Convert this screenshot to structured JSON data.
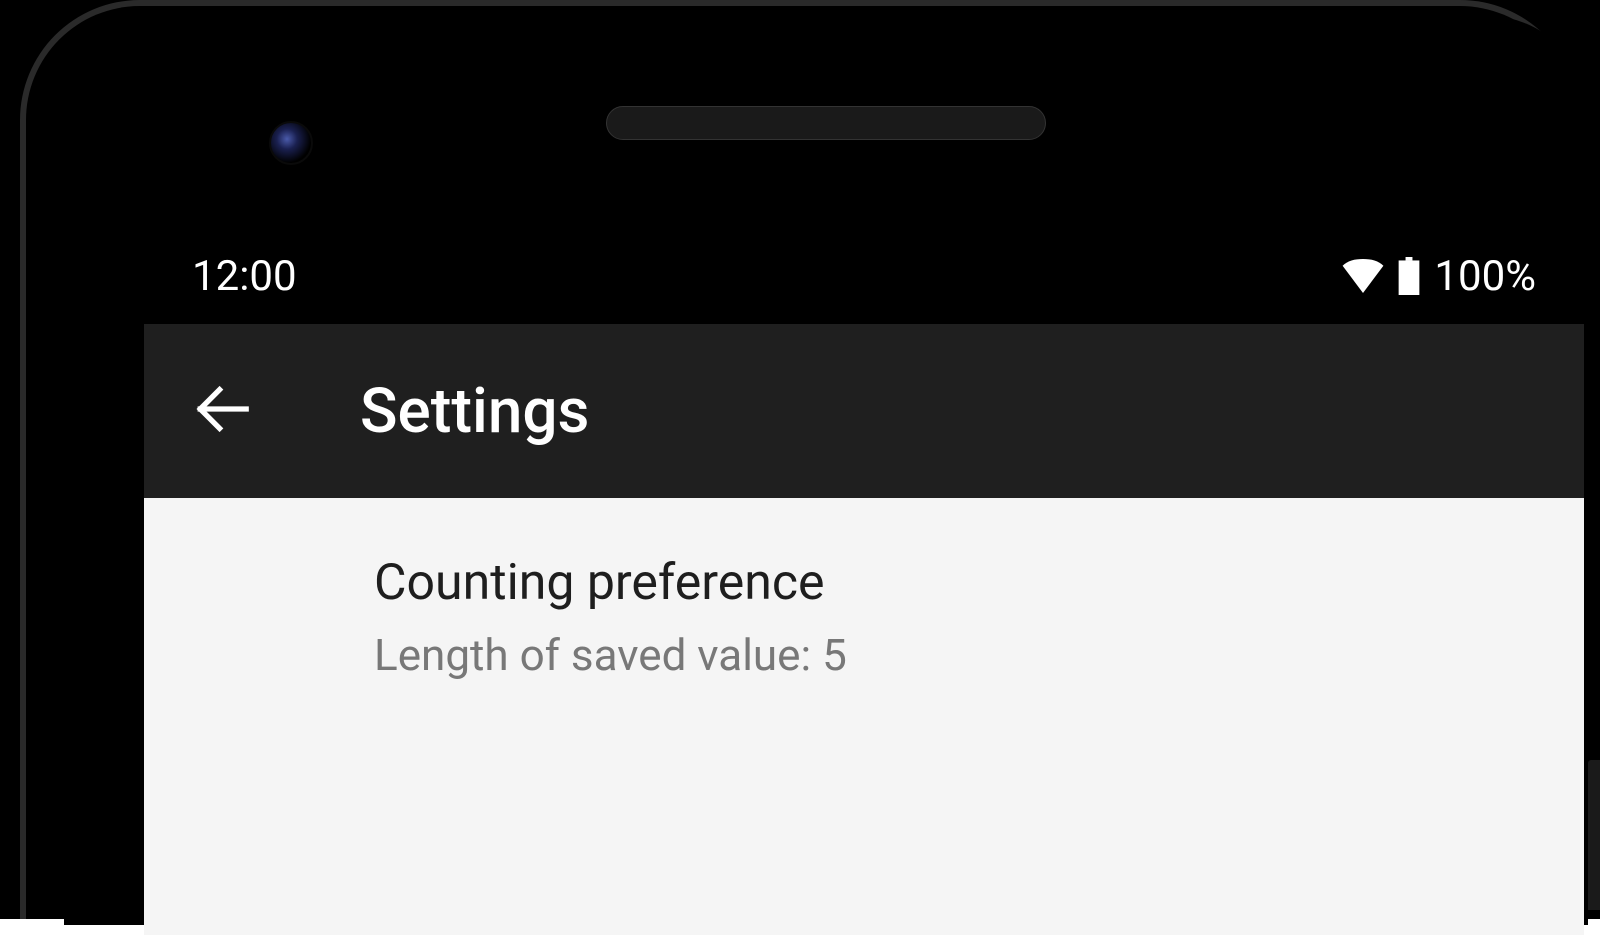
{
  "status_bar": {
    "time": "12:00",
    "battery_percent": "100%"
  },
  "app_bar": {
    "title": "Settings"
  },
  "preferences": {
    "counting": {
      "title": "Counting preference",
      "summary": "Length of saved value: 5"
    }
  }
}
